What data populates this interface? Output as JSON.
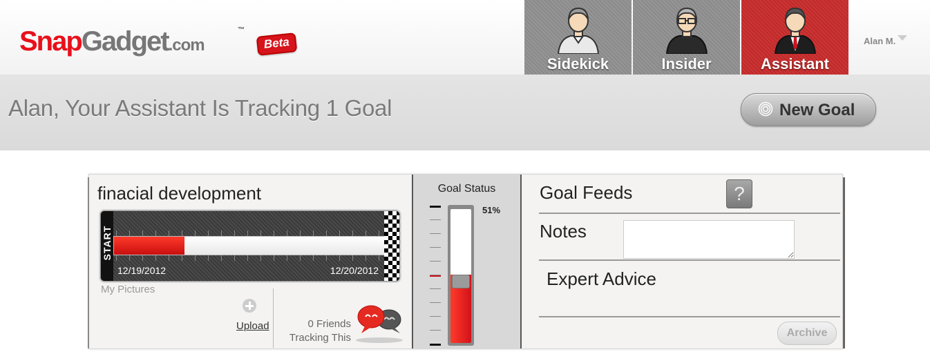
{
  "brand": {
    "name_part1": "Snap",
    "name_part2": "Gadget",
    "suffix": ".com",
    "trademark": "™",
    "badge": "Beta",
    "colors": {
      "red": "#e8101a",
      "gray": "#777777"
    }
  },
  "role_tabs": [
    {
      "label": "Sidekick",
      "icon": "sidekick-avatar-icon",
      "active": false
    },
    {
      "label": "Insider",
      "icon": "insider-avatar-icon",
      "active": false
    },
    {
      "label": "Assistant",
      "icon": "assistant-avatar-icon",
      "active": true
    }
  ],
  "user_menu": {
    "name": "Alan M."
  },
  "page": {
    "title": "Alan, Your Assistant Is Tracking 1 Goal",
    "new_goal_label": "New Goal"
  },
  "goal": {
    "name": "finacial development",
    "start_label": "START",
    "start_date": "12/19/2012",
    "end_date": "12/20/2012",
    "progress_fraction": 0.26,
    "my_pictures_label": "My Pictures",
    "upload_label": "Upload",
    "friends_line1": "0 Friends",
    "friends_line2": "Tracking This"
  },
  "goal_status": {
    "title": "Goal Status",
    "percent_label": "51%",
    "level": 0.51
  },
  "feeds": {
    "title": "Goal Feeds",
    "help_label": "?",
    "notes_label": "Notes",
    "notes_value": "",
    "expert_advice_label": "Expert Advice",
    "archive_label": "Archive"
  }
}
